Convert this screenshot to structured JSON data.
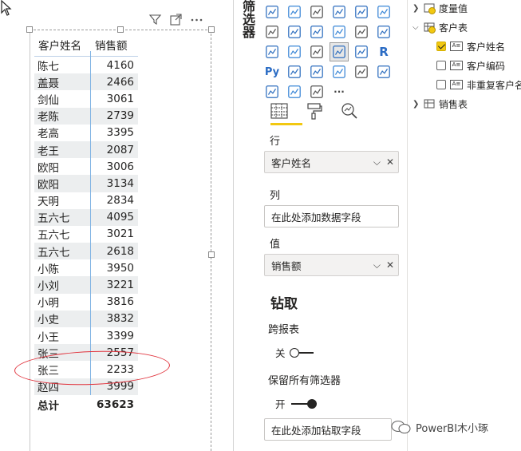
{
  "table": {
    "headers": [
      "客户姓名",
      "销售额"
    ],
    "rows": [
      [
        "陈七",
        "4160"
      ],
      [
        "盖聂",
        "2466"
      ],
      [
        "剑仙",
        "3061"
      ],
      [
        "老陈",
        "2739"
      ],
      [
        "老高",
        "3395"
      ],
      [
        "老王",
        "2087"
      ],
      [
        "欧阳",
        "3006"
      ],
      [
        "欧阳",
        "3134"
      ],
      [
        "天明",
        "2834"
      ],
      [
        "五六七",
        "4095"
      ],
      [
        "五六七",
        "3021"
      ],
      [
        "五六七",
        "2618"
      ],
      [
        "小陈",
        "3950"
      ],
      [
        "小刘",
        "3221"
      ],
      [
        "小明",
        "3816"
      ],
      [
        "小史",
        "3832"
      ],
      [
        "小王",
        "3399"
      ],
      [
        "张三",
        "2557"
      ],
      [
        "张三",
        "2233"
      ],
      [
        "赵四",
        "3999"
      ]
    ],
    "total_label": "总计",
    "total_value": "63623"
  },
  "viz_pane": {
    "title": "筛选器",
    "icons": [
      "stacked-column-chart-icon",
      "funnel-chart-icon",
      "scatter-chart-icon",
      "pie-chart-icon",
      "donut-chart-icon",
      "treemap-icon",
      "map-icon",
      "filled-map-icon",
      "shape-map-icon",
      "azure-map-icon",
      "gauge-icon",
      "card-icon",
      "multi-row-card-icon",
      "kpi-icon",
      "slicer-icon",
      "table-icon",
      "matrix-icon",
      "r-visual-icon",
      "python-visual-icon",
      "key-influencers-icon",
      "decomposition-tree-icon",
      "qa-icon",
      "smart-narrative-icon",
      "paginated-report-icon",
      "power-apps-icon",
      "power-automate-icon",
      "arcgis-icon",
      "more-visuals-icon"
    ],
    "ai_label": "R",
    "py_label": "Py",
    "ellipsis": "···",
    "rows_label": "行",
    "rows_field": "客户姓名",
    "columns_label": "列",
    "columns_placeholder": "在此处添加数据字段",
    "values_label": "值",
    "values_field": "销售额",
    "drillthrough_title": "钻取",
    "cross_report_label": "跨报表",
    "cross_report_state": "关",
    "keep_filters_label": "保留所有筛选器",
    "keep_filters_state": "开",
    "drill_placeholder": "在此处添加钻取字段"
  },
  "fields_pane": {
    "measure_table": "度量值",
    "customer_table": "客户表",
    "customer_fields": [
      {
        "label": "客户姓名",
        "checked": true
      },
      {
        "label": "客户编码",
        "checked": false
      },
      {
        "label": "非重复客户名",
        "checked": false
      }
    ],
    "sales_table": "销售表"
  },
  "watermark": "PowerBI木小琢"
}
